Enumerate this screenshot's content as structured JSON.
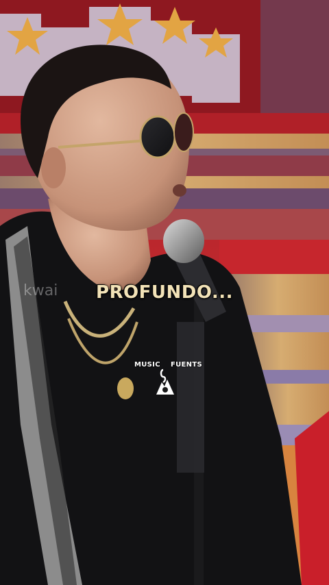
{
  "caption": "PROFUNDO...",
  "watermark": {
    "left": "MUSIC",
    "right": "FUENTS"
  },
  "ghost_watermark": "kwai",
  "colors": {
    "caption": "#f3e3b8",
    "stage_red": "#b11c24",
    "stage_gold": "#d8a54b",
    "jacket": "#121214"
  }
}
